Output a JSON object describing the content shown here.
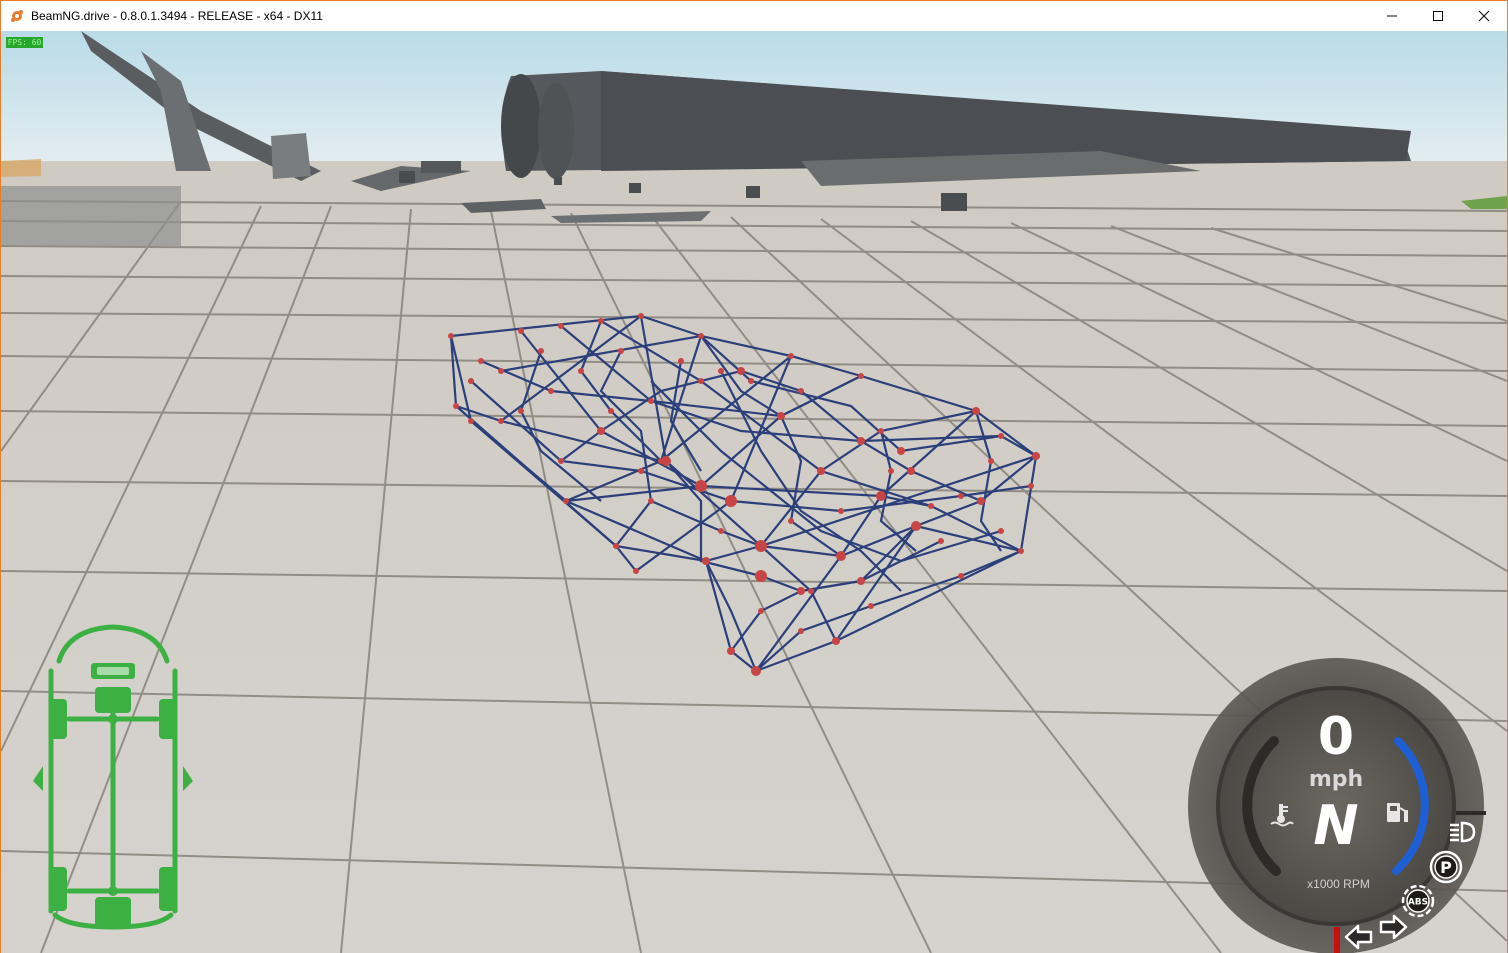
{
  "window": {
    "title": "BeamNG.drive - 0.8.0.1.3494 - RELEASE - x64 - DX11",
    "border_color": "#e87d2b"
  },
  "hud": {
    "fps_label": "FPS: 60",
    "speed": "0",
    "speed_unit": "mph",
    "gear": "N",
    "rpm_label": "x1000 RPM",
    "indicators": [
      "coolant-temp-icon",
      "fuel-icon",
      "headlight-icon",
      "parking-brake-icon",
      "abs-icon",
      "left-turn-signal-icon",
      "right-turn-signal-icon"
    ],
    "damage_color": "#3cb043",
    "gauge_accent": "#1f5fd6"
  },
  "scene": {
    "mesh_line_color": "#2b3f7a",
    "mesh_node_color": "#c84545"
  }
}
